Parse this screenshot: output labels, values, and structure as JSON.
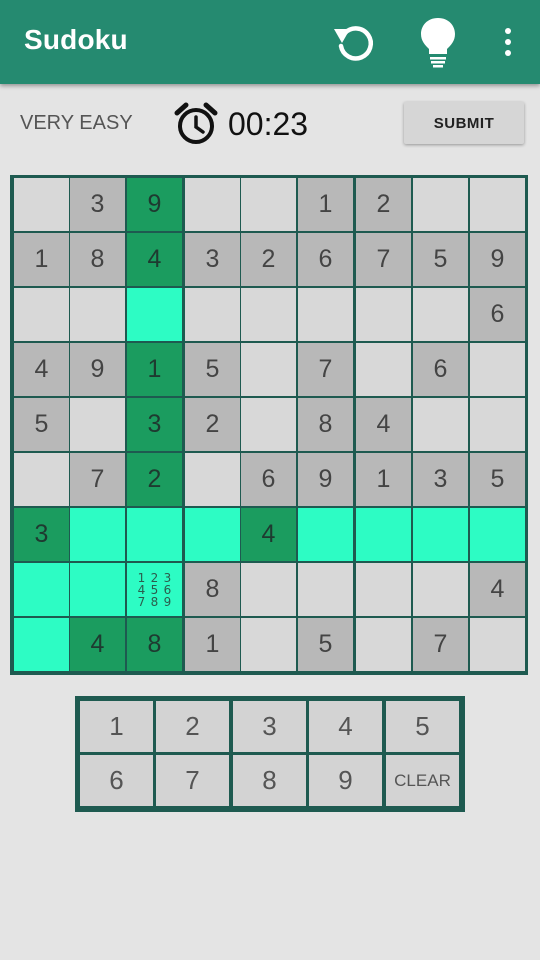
{
  "app": {
    "title": "Sudoku"
  },
  "icons": {
    "refresh": "refresh-icon",
    "hint": "lightbulb-icon",
    "more": "more-vert-icon",
    "alarm": "alarm-clock-icon"
  },
  "status": {
    "difficulty": "VERY EASY",
    "timer": "00:23",
    "submit_label": "SUBMIT"
  },
  "colors": {
    "appbar": "#258a70",
    "grid_line": "#1e5a50",
    "given": "#b8b8b8",
    "empty": "#d8d8d8",
    "highlight": "#2dfcc4",
    "selected": "#1b9c5f"
  },
  "board": {
    "rows": [
      [
        {
          "v": "",
          "s": "empty"
        },
        {
          "v": "3",
          "s": "given"
        },
        {
          "v": "9",
          "s": "sel"
        },
        {
          "v": "",
          "s": "empty"
        },
        {
          "v": "",
          "s": "empty"
        },
        {
          "v": "1",
          "s": "given"
        },
        {
          "v": "2",
          "s": "given"
        },
        {
          "v": "",
          "s": "empty"
        },
        {
          "v": "",
          "s": "empty"
        }
      ],
      [
        {
          "v": "1",
          "s": "given"
        },
        {
          "v": "8",
          "s": "given"
        },
        {
          "v": "4",
          "s": "sel"
        },
        {
          "v": "3",
          "s": "given"
        },
        {
          "v": "2",
          "s": "given"
        },
        {
          "v": "6",
          "s": "given"
        },
        {
          "v": "7",
          "s": "given"
        },
        {
          "v": "5",
          "s": "given"
        },
        {
          "v": "9",
          "s": "given"
        }
      ],
      [
        {
          "v": "",
          "s": "empty"
        },
        {
          "v": "",
          "s": "empty"
        },
        {
          "v": "",
          "s": "hl"
        },
        {
          "v": "",
          "s": "empty"
        },
        {
          "v": "",
          "s": "empty"
        },
        {
          "v": "",
          "s": "empty"
        },
        {
          "v": "",
          "s": "empty"
        },
        {
          "v": "",
          "s": "empty"
        },
        {
          "v": "6",
          "s": "given"
        }
      ],
      [
        {
          "v": "4",
          "s": "given"
        },
        {
          "v": "9",
          "s": "given"
        },
        {
          "v": "1",
          "s": "sel"
        },
        {
          "v": "5",
          "s": "given"
        },
        {
          "v": "",
          "s": "empty"
        },
        {
          "v": "7",
          "s": "given"
        },
        {
          "v": "",
          "s": "empty"
        },
        {
          "v": "6",
          "s": "given"
        },
        {
          "v": "",
          "s": "empty"
        }
      ],
      [
        {
          "v": "5",
          "s": "given"
        },
        {
          "v": "",
          "s": "empty"
        },
        {
          "v": "3",
          "s": "sel"
        },
        {
          "v": "2",
          "s": "given"
        },
        {
          "v": "",
          "s": "empty"
        },
        {
          "v": "8",
          "s": "given"
        },
        {
          "v": "4",
          "s": "given"
        },
        {
          "v": "",
          "s": "empty"
        },
        {
          "v": "",
          "s": "empty"
        }
      ],
      [
        {
          "v": "",
          "s": "empty"
        },
        {
          "v": "7",
          "s": "given"
        },
        {
          "v": "2",
          "s": "sel"
        },
        {
          "v": "",
          "s": "empty"
        },
        {
          "v": "6",
          "s": "given"
        },
        {
          "v": "9",
          "s": "given"
        },
        {
          "v": "1",
          "s": "given"
        },
        {
          "v": "3",
          "s": "given"
        },
        {
          "v": "5",
          "s": "given"
        }
      ],
      [
        {
          "v": "3",
          "s": "sel"
        },
        {
          "v": "",
          "s": "hl"
        },
        {
          "v": "",
          "s": "hl"
        },
        {
          "v": "",
          "s": "hl"
        },
        {
          "v": "4",
          "s": "sel"
        },
        {
          "v": "",
          "s": "hl"
        },
        {
          "v": "",
          "s": "hl"
        },
        {
          "v": "",
          "s": "hl"
        },
        {
          "v": "",
          "s": "hl"
        }
      ],
      [
        {
          "v": "",
          "s": "hl"
        },
        {
          "v": "",
          "s": "hl"
        },
        {
          "v": "",
          "s": "hl",
          "notes": [
            "1",
            "2",
            "3",
            "4",
            "5",
            "6",
            "7",
            "8",
            "9"
          ]
        },
        {
          "v": "8",
          "s": "given"
        },
        {
          "v": "",
          "s": "empty"
        },
        {
          "v": "",
          "s": "empty"
        },
        {
          "v": "",
          "s": "empty"
        },
        {
          "v": "",
          "s": "empty"
        },
        {
          "v": "4",
          "s": "given"
        }
      ],
      [
        {
          "v": "",
          "s": "hl"
        },
        {
          "v": "4",
          "s": "sel"
        },
        {
          "v": "8",
          "s": "sel"
        },
        {
          "v": "1",
          "s": "given"
        },
        {
          "v": "",
          "s": "empty"
        },
        {
          "v": "5",
          "s": "given"
        },
        {
          "v": "",
          "s": "empty"
        },
        {
          "v": "7",
          "s": "given"
        },
        {
          "v": "",
          "s": "empty"
        }
      ]
    ]
  },
  "keypad": {
    "keys": [
      "1",
      "2",
      "3",
      "4",
      "5",
      "6",
      "7",
      "8",
      "9",
      "CLEAR"
    ]
  }
}
